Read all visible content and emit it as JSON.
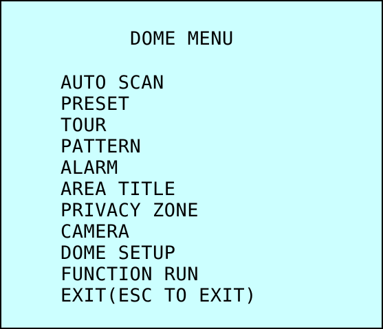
{
  "menu": {
    "title": "DOME MENU",
    "items": [
      {
        "label": "AUTO SCAN"
      },
      {
        "label": "PRESET"
      },
      {
        "label": "TOUR"
      },
      {
        "label": "PATTERN"
      },
      {
        "label": "ALARM"
      },
      {
        "label": "AREA TITLE"
      },
      {
        "label": "PRIVACY ZONE"
      },
      {
        "label": "CAMERA"
      },
      {
        "label": "DOME SETUP"
      },
      {
        "label": "FUNCTION RUN"
      },
      {
        "label": "EXIT(ESC TO EXIT)"
      }
    ]
  },
  "colors": {
    "panel_background": "#ccffff",
    "border": "#000000",
    "text": "#000000"
  }
}
